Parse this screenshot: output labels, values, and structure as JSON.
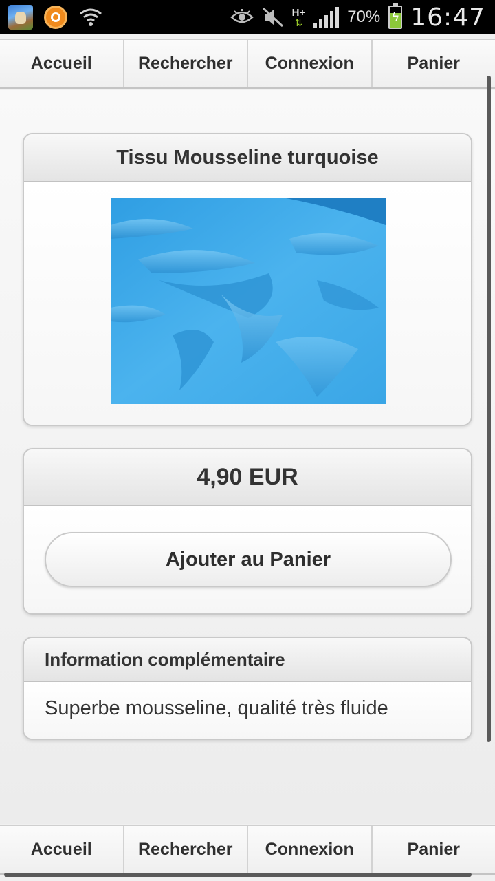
{
  "status_bar": {
    "battery_percent": "70%",
    "time": "16:47",
    "network": "H+",
    "icons": [
      "app-game-icon",
      "app-orange-icon",
      "wifi-hotspot-icon",
      "eye-icon",
      "mute-icon",
      "network-arrows-icon",
      "signal-icon",
      "battery-icon"
    ]
  },
  "nav_top": [
    "Accueil",
    "Rechercher",
    "Connexion",
    "Panier"
  ],
  "nav_bottom": [
    "Accueil",
    "Rechercher",
    "Connexion",
    "Panier"
  ],
  "product": {
    "title": "Tissu Mousseline turquoise",
    "image_color": "#3aa6e6",
    "price": "4,90 EUR",
    "add_button": "Ajouter au Panier"
  },
  "info": {
    "heading": "Information complémentaire",
    "text": "Superbe mousseline, qualité très fluide"
  }
}
